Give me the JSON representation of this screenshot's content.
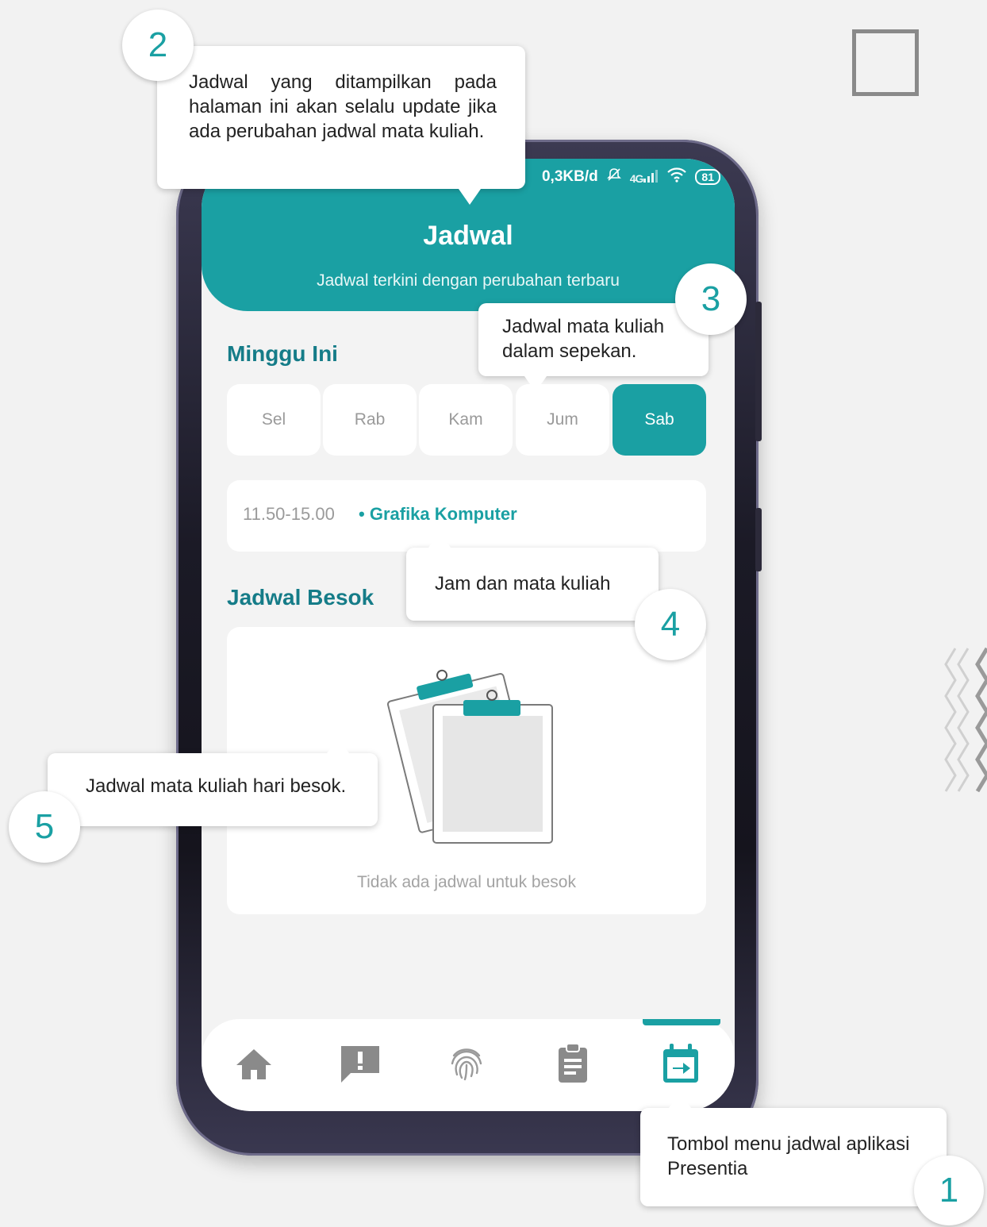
{
  "status_bar": {
    "network_speed": "0,3KB/d",
    "signal": "4G",
    "battery": "81"
  },
  "header": {
    "title": "Jadwal",
    "subtitle": "Jadwal terkini dengan perubahan terbaru"
  },
  "week": {
    "title": "Minggu Ini",
    "days": [
      {
        "label": "Sel",
        "active": false
      },
      {
        "label": "Rab",
        "active": false
      },
      {
        "label": "Kam",
        "active": false
      },
      {
        "label": "Jum",
        "active": false
      },
      {
        "label": "Sab",
        "active": true
      }
    ]
  },
  "schedule": {
    "time": "11.50-15.00",
    "separator": "•",
    "course": "Grafika Komputer"
  },
  "tomorrow": {
    "title": "Jadwal Besok",
    "empty_text": "Tidak ada jadwal untuk besok"
  },
  "bottom_nav": {
    "items": [
      {
        "icon": "home-icon",
        "active": false
      },
      {
        "icon": "report-icon",
        "active": false
      },
      {
        "icon": "fingerprint-icon",
        "active": false
      },
      {
        "icon": "clipboard-icon",
        "active": false
      },
      {
        "icon": "calendar-icon",
        "active": true
      }
    ]
  },
  "callouts": {
    "c1": {
      "number": "1",
      "text": "Tombol menu jadwal aplikasi Presentia"
    },
    "c2": {
      "number": "2",
      "text": "Jadwal yang ditampilkan pada halaman ini akan selalu update jika ada perubahan jadwal mata kuliah."
    },
    "c3": {
      "number": "3",
      "text": "Jadwal mata kuliah dalam sepekan."
    },
    "c4": {
      "number": "4",
      "text": "Jam dan mata kuliah"
    },
    "c5": {
      "number": "5",
      "text": "Jadwal mata kuliah hari besok."
    }
  },
  "colors": {
    "accent": "#1aa0a3",
    "heading": "#157c88",
    "background": "#f3f3f3",
    "muted": "#9a9a9a"
  }
}
